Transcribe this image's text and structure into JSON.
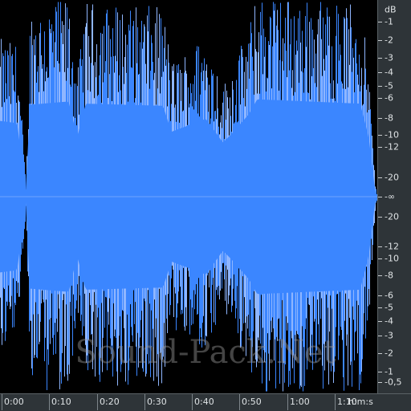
{
  "colors": {
    "waveform": "#3b86ff",
    "waveform_edge": "#8fb6ff",
    "background": "#000000",
    "ruler": "#2e3438",
    "text": "#e0e4e6"
  },
  "db_scale": {
    "unit": "dB",
    "labels": [
      {
        "text": "-1",
        "db": -1,
        "half": "top"
      },
      {
        "text": "-2",
        "db": -2,
        "half": "top"
      },
      {
        "text": "-3",
        "db": -3,
        "half": "top"
      },
      {
        "text": "-4",
        "db": -4,
        "half": "top"
      },
      {
        "text": "-5",
        "db": -5,
        "half": "top"
      },
      {
        "text": "-6",
        "db": -6,
        "half": "top"
      },
      {
        "text": "-8",
        "db": -8,
        "half": "top"
      },
      {
        "text": "-10",
        "db": -10,
        "half": "top"
      },
      {
        "text": "-12",
        "db": -12,
        "half": "top"
      },
      {
        "text": "-20",
        "db": -20,
        "half": "top"
      },
      {
        "text": "-∞",
        "db": "-inf",
        "half": "center"
      },
      {
        "text": "-20",
        "db": -20,
        "half": "bottom"
      },
      {
        "text": "-12",
        "db": -12,
        "half": "bottom"
      },
      {
        "text": "-10",
        "db": -10,
        "half": "bottom"
      },
      {
        "text": "-8",
        "db": -8,
        "half": "bottom"
      },
      {
        "text": "-6",
        "db": -6,
        "half": "bottom"
      },
      {
        "text": "-5",
        "db": -5,
        "half": "bottom"
      },
      {
        "text": "-4",
        "db": -4,
        "half": "bottom"
      },
      {
        "text": "-3",
        "db": -3,
        "half": "bottom"
      },
      {
        "text": "-2",
        "db": -2,
        "half": "bottom"
      },
      {
        "text": "-1",
        "db": -1,
        "half": "bottom"
      },
      {
        "text": "-0,5",
        "db": -0.5,
        "half": "bottom"
      }
    ]
  },
  "time_ruler": {
    "unit": "h:m:s",
    "labels": [
      "0:00",
      "0:10",
      "0:20",
      "0:30",
      "0:40",
      "0:50",
      "1:00",
      "1:10"
    ],
    "seconds": [
      0,
      10,
      20,
      30,
      40,
      50,
      60,
      70
    ],
    "duration_seconds": 88
  },
  "waveform": {
    "envelope": [
      {
        "t": 0,
        "amp": 0.7
      },
      {
        "t": 4,
        "amp": 0.68
      },
      {
        "t": 6,
        "amp": 0.05
      },
      {
        "t": 7,
        "amp": 0.85
      },
      {
        "t": 16,
        "amp": 0.88
      },
      {
        "t": 18,
        "amp": 0.55
      },
      {
        "t": 20,
        "amp": 0.86
      },
      {
        "t": 38,
        "amp": 0.84
      },
      {
        "t": 40,
        "amp": 0.6
      },
      {
        "t": 48,
        "amp": 0.72
      },
      {
        "t": 52,
        "amp": 0.5
      },
      {
        "t": 54,
        "amp": 0.58
      },
      {
        "t": 58,
        "amp": 0.76
      },
      {
        "t": 60,
        "amp": 0.9
      },
      {
        "t": 84,
        "amp": 0.86
      },
      {
        "t": 86,
        "amp": 0.55
      },
      {
        "t": 87.5,
        "amp": 0.05
      },
      {
        "t": 88,
        "amp": 0.0
      }
    ]
  },
  "watermark": "Sound-Pack.Net"
}
